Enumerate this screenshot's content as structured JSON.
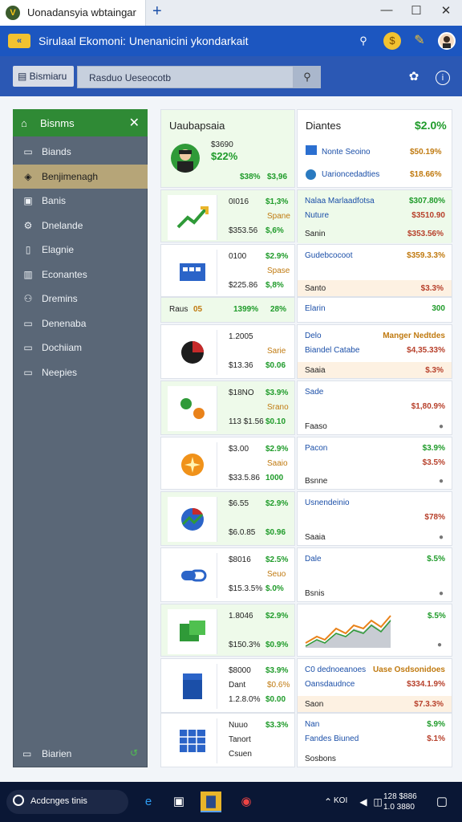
{
  "browser": {
    "tab_title": "Uonadansyia wbtaingar",
    "tab_logo": "V",
    "new_tab": "+",
    "minimize": "—",
    "maximize": "☐",
    "close": "✕"
  },
  "header": {
    "app_icon_label": "«",
    "title": "Sirulaal Ekomoni: Unenanicini ykondarkait"
  },
  "toolbar": {
    "breadcrumb": "Bismiaru",
    "search_value": "Rasduo Ueseocotb",
    "search_icon": "search-icon"
  },
  "sidebar": {
    "header": "Bisnms",
    "items": [
      {
        "icon": "folder",
        "label": "Biands"
      },
      {
        "icon": "wallet",
        "label": "Benjimenagh"
      },
      {
        "icon": "box",
        "label": "Banis"
      },
      {
        "icon": "gear",
        "label": "Dnelande"
      },
      {
        "icon": "doc",
        "label": "Elagnie"
      },
      {
        "icon": "chart",
        "label": "Econantes"
      },
      {
        "icon": "people",
        "label": "Dremins"
      },
      {
        "icon": "doc2",
        "label": "Denenaba"
      },
      {
        "icon": "monitor",
        "label": "Dochiiam"
      },
      {
        "icon": "folder2",
        "label": "Neepies"
      }
    ],
    "footer": "Biarien",
    "footer_right": "↺"
  },
  "summary": {
    "title": "Uaubapsaia",
    "small": "$3690",
    "big": "$22%",
    "stat1": "$38%",
    "stat2": "$3,96"
  },
  "right_header": {
    "title": "Diantes",
    "value": "$2.0%",
    "row1_label": "Nonte Seoino",
    "row1_value": "$50.19%",
    "row2_label": "Uarioncedadties",
    "row2_value": "$18.66%"
  },
  "left_cards": [
    {
      "icon": "trend-arrow-icon",
      "l1": "0I016",
      "v1": "$1,3%",
      "l2": "",
      "v2": "Spane",
      "l3": "$353.56",
      "v3": "$,6%"
    },
    {
      "icon": "blue-app-icon",
      "l1": "0100",
      "v1": "$2.9%",
      "l2": "",
      "v2": "Spase",
      "l3": "$225.86",
      "v3": "$,8%"
    },
    {
      "icon": "",
      "l1": "Raus",
      "v1": "1399%",
      "l2": "",
      "v2": "28%",
      "l3": "",
      "v3": "",
      "badge": "05"
    },
    {
      "icon": "pie-icon",
      "l1": "1.2005",
      "v1": "",
      "l2": "",
      "v2": "Sarie",
      "l3": "$13.36",
      "v3": "$0.06"
    },
    {
      "icon": "dots-icon",
      "l1": "$18NO",
      "v1": "$3.9%",
      "l2": "",
      "v2": "Srano",
      "l3": "113 $1.56",
      "v3": "$0.10"
    },
    {
      "icon": "sun-icon",
      "l1": "$3.00",
      "v1": "$2.9%",
      "l2": "",
      "v2": "Saaio",
      "l3": "$33.5.86",
      "v3": "1000"
    },
    {
      "icon": "chrome-icon",
      "l1": "$6.55",
      "v1": "$2.9%",
      "l2": "",
      "v2": "",
      "l3": "$6.0.85",
      "v3": "$0.96"
    },
    {
      "icon": "link-icon",
      "l1": "$8016",
      "v1": "$2.5%",
      "l2": "",
      "v2": "Seuo",
      "l3": "$15.3.5%",
      "v3": "$.0%"
    },
    {
      "icon": "green-app-icon",
      "l1": "1.8046",
      "v1": "$2.9%",
      "l2": "",
      "v2": "",
      "l3": "$150.3%",
      "v3": "$0.9%"
    },
    {
      "icon": "file-icon",
      "l1": "$8000",
      "v1": "$3.9%",
      "l2": "Dant",
      "v2": "$0.6%",
      "l3": "1.2.8.0%",
      "v3": "$0.00"
    },
    {
      "icon": "grid-icon",
      "l1": "Nuuo",
      "v1": "$3.3%",
      "l2": "Tanort",
      "v2": "",
      "l3": "Csuen",
      "v3": ""
    }
  ],
  "right_cards": [
    {
      "r1l": "Nalaa Marlaadfotsa",
      "r1v": "$307.80%",
      "r2l": "Nuture",
      "r2v": "$3510.90",
      "r3l": "Sanin",
      "r3v": "$353.56%",
      "tint": "green"
    },
    {
      "r1l": "Gudebcocoot",
      "r1v": "$359.3.3%",
      "r2l": "",
      "r2v": "",
      "r3l": "Santo",
      "r3v": "$3.3%",
      "tint": "orange"
    },
    {
      "r1l": "Elarin",
      "r1v": "300",
      "r2l": "",
      "r2v": "",
      "r3l": "",
      "r3v": "",
      "tint": "none"
    },
    {
      "r1l": "Delo",
      "r1v": "Manger Nedtdes",
      "r2l": "Biandel Catabe",
      "r2v": "$4,35.33%",
      "r3l": "Saaia",
      "r3v": "$.3%",
      "tint": "orange"
    },
    {
      "r1l": "Sade",
      "r1v": "",
      "r2l": "",
      "r2v": "$1,80.9%",
      "r3l": "Faaso",
      "r3v": "●",
      "tint": "none"
    },
    {
      "r1l": "Pacon",
      "r1v": "$3.9%",
      "r2l": "",
      "r2v": "$3.5%",
      "r3l": "Bsnne",
      "r3v": "●",
      "tint": "none"
    },
    {
      "r1l": "Usnendeinio",
      "r1v": "",
      "r2l": "",
      "r2v": "$78%",
      "r3l": "Saaia",
      "r3v": "●",
      "tint": "none"
    },
    {
      "r1l": "Dale",
      "r1v": "$.5%",
      "r2l": "",
      "r2v": "",
      "r3l": "Bsnis",
      "r3v": "●",
      "tint": "none"
    },
    {
      "r1l": "",
      "r1v": "$.5%",
      "r2l": "",
      "r2v": "",
      "r3l": "",
      "r3v": "●",
      "tint": "chart"
    },
    {
      "r1l": "C0 dednoeanoes",
      "r1v": "Uase Osdsonidoes",
      "r2l": "Oansdaudnce",
      "r2v": "$334.1.9%",
      "r3l": "Saon",
      "r3v": "$7.3.3%",
      "tint": "orange"
    },
    {
      "r1l": "Nan",
      "r1v": "$.9%",
      "r2l": "Fandes Biuned",
      "r2v": "$.1%",
      "r3l": "Sosbons",
      "r3v": "",
      "tint": "none"
    }
  ],
  "taskbar": {
    "search_text": "Acdcnges tinis",
    "clock_line1": "128 $886",
    "clock_line2": "1.0 3880",
    "tray_label": "KOI"
  },
  "colors": {
    "header_blue": "#1c56c0",
    "sidebar_green": "#2f8a35",
    "positive_green": "#1f9b2a",
    "warning_orange": "#c07a10",
    "negative_red": "#b7402b"
  }
}
